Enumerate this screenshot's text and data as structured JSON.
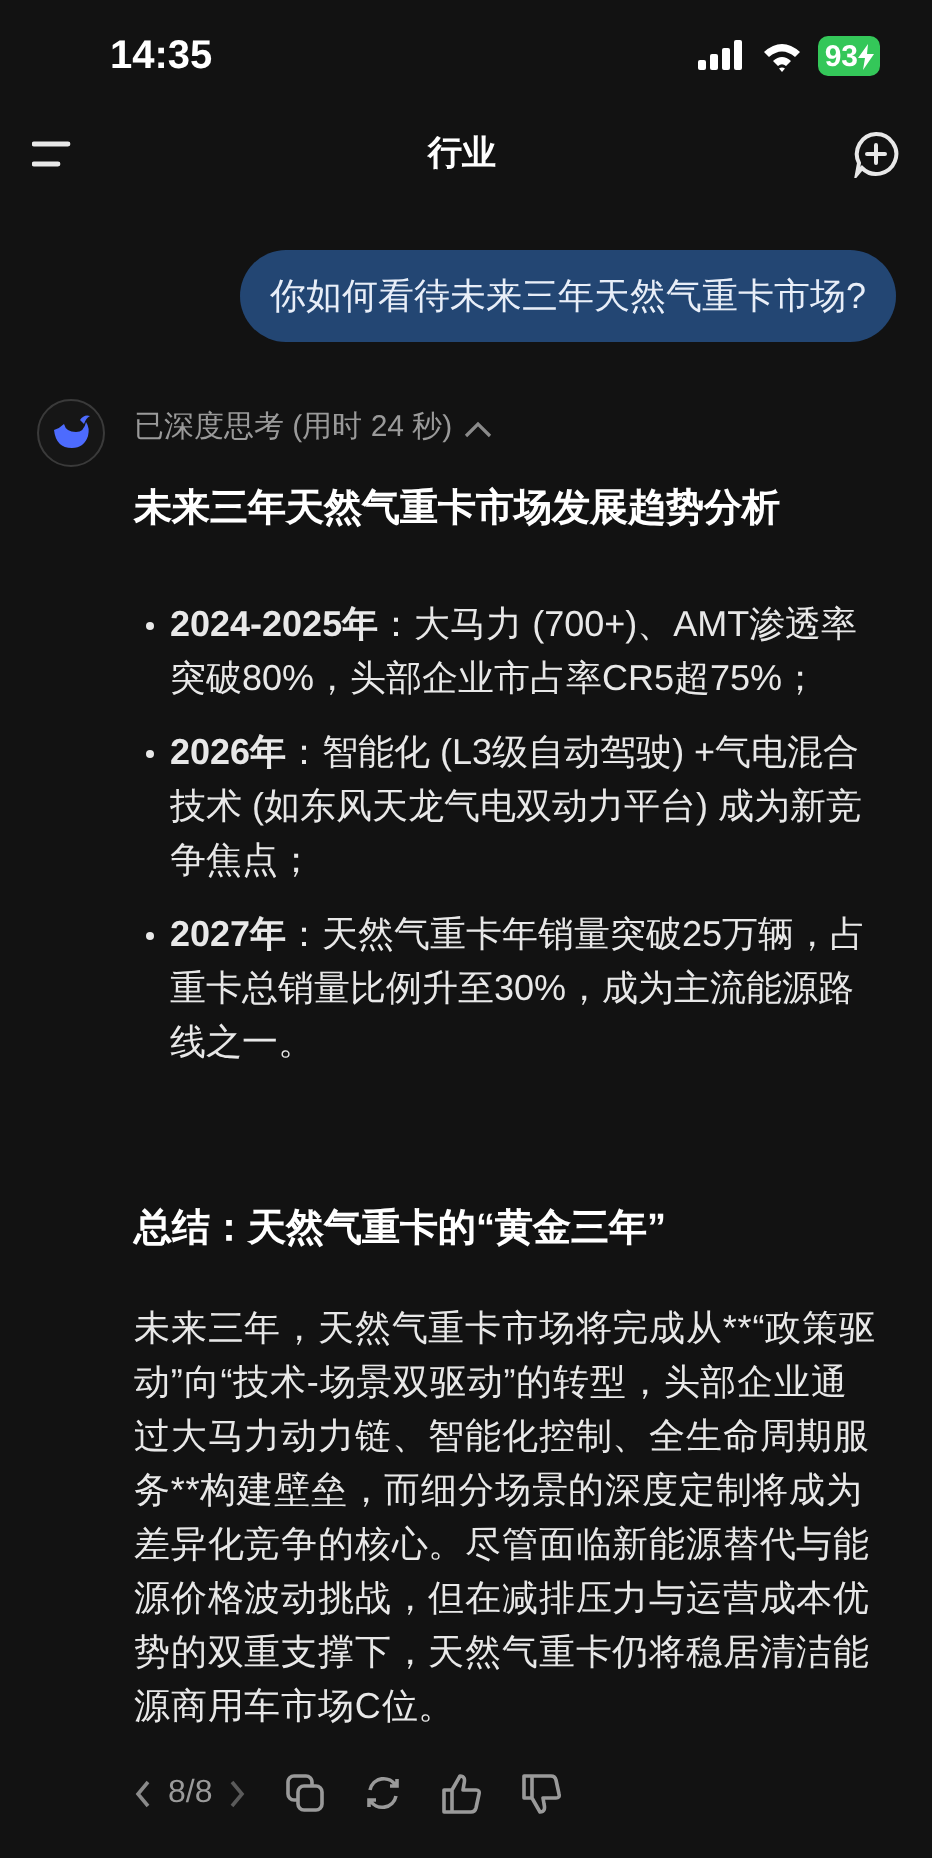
{
  "status_bar": {
    "time": "14:35",
    "battery": "93"
  },
  "header": {
    "title": "行业"
  },
  "user_message": "你如何看待未来三年天然气重卡市场?",
  "reply": {
    "thinking_label": "已深度思考 (用时 24 秒)",
    "thinking_expanded": true,
    "heading": "未来三年天然气重卡市场发展趋势分析",
    "bullets": [
      {
        "text": "**2024-2025年**：大马力 (700+)、AMT渗透率突破80%，头部企业市占率CR5超75%；"
      },
      {
        "text": "**2026年**：智能化 (L3级自动驾驶) +气电混合技术 (如东风天龙气电双动力平台) 成为新竞争焦点；"
      },
      {
        "text": "**2027年**：天然气重卡年销量突破25万辆，占重卡总销量比例升至30%，成为主流能源路线之一。"
      }
    ],
    "summary_heading": "总结：天然气重卡的“黄金三年”",
    "summary": "未来三年，天然气重卡市场将完成从**“政策驱动”向“技术-场景双驱动”的转型，头部企业通过大马力动力链、智能化控制、全生命周期服务**构建壁垒，而细分场景的深度定制将成为差异化竞争的核心。尽管面临新能源替代与能源价格波动挑战，但在减排压力与运营成本优势的双重支撑下，天然气重卡仍将稳居清洁能源商用车市场C位。",
    "pager": "8/8"
  }
}
